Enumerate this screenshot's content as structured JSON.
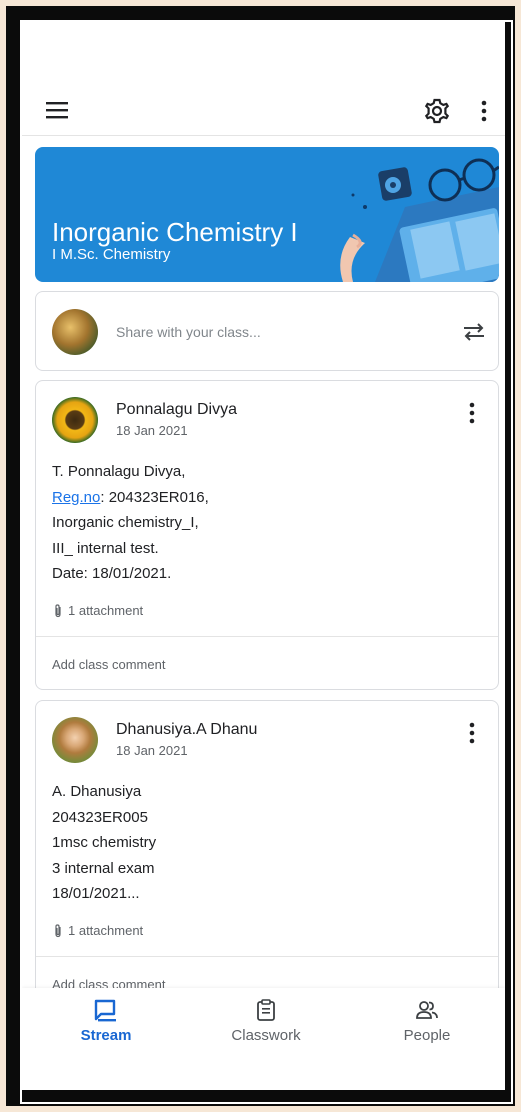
{
  "colors": {
    "accent": "#1967d2",
    "banner": "#1f88d6",
    "link": "#1a73e8"
  },
  "topbar": {
    "icons": [
      "menu-icon",
      "gear-icon",
      "more-vert-icon"
    ]
  },
  "banner": {
    "title": "Inorganic Chemistry I",
    "subtitle": "I M.Sc. Chemistry"
  },
  "share": {
    "placeholder": "Share with your class...",
    "icon": "repost-icon"
  },
  "posts": [
    {
      "author": "Ponnalagu Divya",
      "date": "18 Jan 2021",
      "lines": [
        "T. Ponnalagu Divya,",
        "Reg.no",
        ": 204323ER016,",
        "Inorganic chemistry_I,",
        "III_ internal test.",
        "Date: 18/01/2021."
      ],
      "attachment": "1 attachment",
      "comment_placeholder": "Add class comment"
    },
    {
      "author": "Dhanusiya.A Dhanu",
      "date": "18 Jan 2021",
      "lines": [
        "A. Dhanusiya",
        "204323ER005",
        "1msc chemistry",
        "3 internal exam",
        "18/01/2021..."
      ],
      "attachment": "1 attachment",
      "comment_placeholder": "Add class comment"
    }
  ],
  "nav": {
    "stream": "Stream",
    "classwork": "Classwork",
    "people": "People"
  }
}
